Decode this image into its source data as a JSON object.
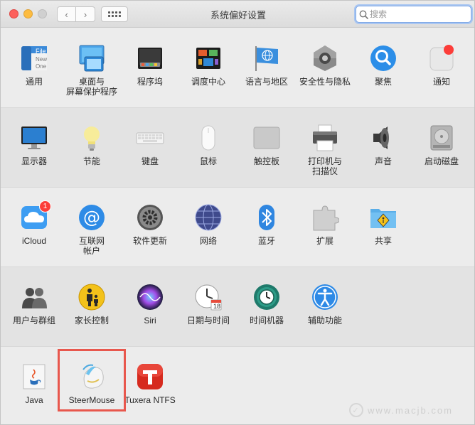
{
  "window": {
    "title": "系统偏好设置",
    "search_placeholder": "搜索"
  },
  "nav": {
    "back": "‹",
    "forward": "›"
  },
  "rows": [
    [
      {
        "label": "通用",
        "icon": "general-icon"
      },
      {
        "label": "桌面与\n屏幕保护程序",
        "icon": "desktop-icon"
      },
      {
        "label": "程序坞",
        "icon": "dock-icon"
      },
      {
        "label": "调度中心",
        "icon": "mission-control-icon"
      },
      {
        "label": "语言与地区",
        "icon": "language-icon"
      },
      {
        "label": "安全性与隐私",
        "icon": "security-icon"
      },
      {
        "label": "聚焦",
        "icon": "spotlight-icon"
      },
      {
        "label": "通知",
        "icon": "notifications-icon"
      }
    ],
    [
      {
        "label": "显示器",
        "icon": "display-icon"
      },
      {
        "label": "节能",
        "icon": "energy-icon"
      },
      {
        "label": "键盘",
        "icon": "keyboard-icon"
      },
      {
        "label": "鼠标",
        "icon": "mouse-icon"
      },
      {
        "label": "触控板",
        "icon": "trackpad-icon"
      },
      {
        "label": "打印机与\n扫描仪",
        "icon": "printer-icon"
      },
      {
        "label": "声音",
        "icon": "sound-icon"
      },
      {
        "label": "启动磁盘",
        "icon": "startup-disk-icon"
      }
    ],
    [
      {
        "label": "iCloud",
        "icon": "icloud-icon",
        "badge": "1"
      },
      {
        "label": "互联网\n帐户",
        "icon": "internet-accounts-icon"
      },
      {
        "label": "软件更新",
        "icon": "software-update-icon"
      },
      {
        "label": "网络",
        "icon": "network-icon"
      },
      {
        "label": "蓝牙",
        "icon": "bluetooth-icon"
      },
      {
        "label": "扩展",
        "icon": "extensions-icon"
      },
      {
        "label": "共享",
        "icon": "sharing-icon"
      }
    ],
    [
      {
        "label": "用户与群组",
        "icon": "users-icon"
      },
      {
        "label": "家长控制",
        "icon": "parental-icon"
      },
      {
        "label": "Siri",
        "icon": "siri-icon"
      },
      {
        "label": "日期与时间",
        "icon": "date-time-icon"
      },
      {
        "label": "时间机器",
        "icon": "time-machine-icon"
      },
      {
        "label": "辅助功能",
        "icon": "accessibility-icon"
      }
    ],
    [
      {
        "label": "Java",
        "icon": "java-icon"
      },
      {
        "label": "SteerMouse",
        "icon": "steermouse-icon"
      },
      {
        "label": "Tuxera NTFS",
        "icon": "tuxera-icon"
      }
    ]
  ],
  "general_icon_text": [
    "File",
    "New",
    "One"
  ],
  "calendar_day": "18",
  "watermark": "www.macjb.com"
}
